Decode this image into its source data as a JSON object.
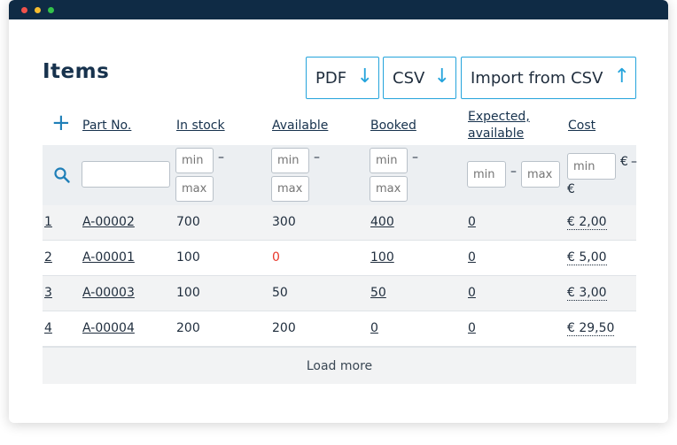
{
  "page": {
    "title": "Items"
  },
  "toolbar": {
    "pdf_label": "PDF",
    "csv_label": "CSV",
    "import_label": "Import from CSV",
    "down_arrow": "↓",
    "up_arrow": "↑"
  },
  "table": {
    "add_symbol": "+",
    "headers": {
      "part_no": "Part No.",
      "in_stock": "In stock",
      "available": "Available",
      "booked": "Booked",
      "expected_line1": "Expected,",
      "expected_line2": "available",
      "cost": "Cost"
    },
    "filters": {
      "min_placeholder": "min",
      "max_placeholder": "max",
      "dash": "–",
      "currency": "€"
    },
    "rows": [
      {
        "num": "1",
        "part": "A-00002",
        "in_stock": "700",
        "available": "300",
        "booked": "400",
        "expected": "0",
        "cost": "€ 2,00"
      },
      {
        "num": "2",
        "part": "A-00001",
        "in_stock": "100",
        "available": "0",
        "booked": "100",
        "expected": "0",
        "cost": "€ 5,00"
      },
      {
        "num": "3",
        "part": "A-00003",
        "in_stock": "100",
        "available": "50",
        "booked": "50",
        "expected": "0",
        "cost": "€ 3,00"
      },
      {
        "num": "4",
        "part": "A-00004",
        "in_stock": "200",
        "available": "200",
        "booked": "0",
        "expected": "0",
        "cost": "€ 29,50"
      }
    ],
    "load_more": "Load more"
  },
  "colors": {
    "titlebar": "#0f2b45",
    "accent": "#25a4dc",
    "negative": "#e8372b"
  }
}
